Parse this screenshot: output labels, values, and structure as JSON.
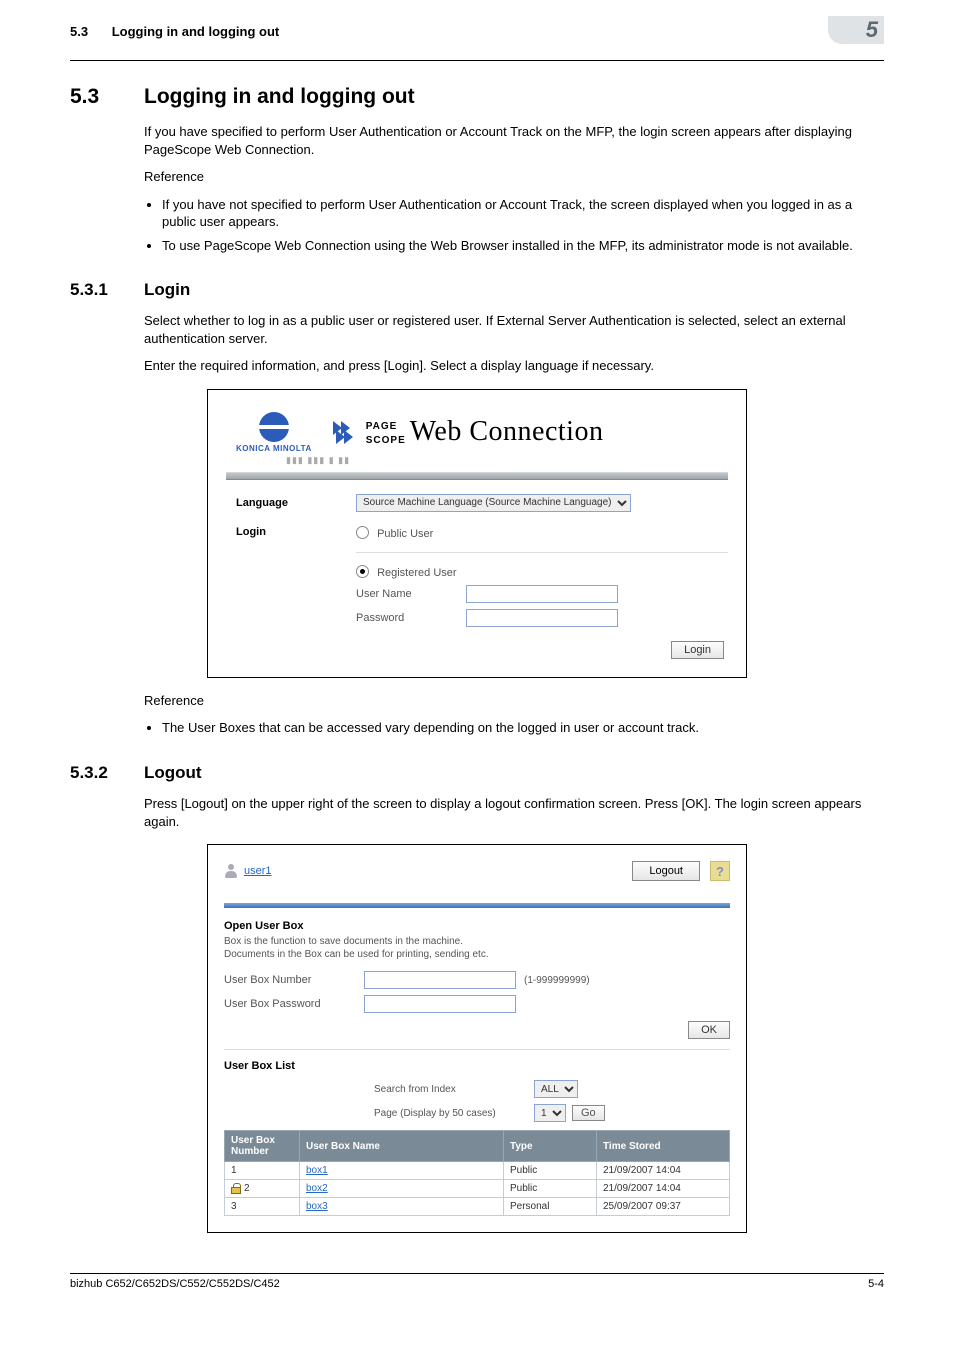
{
  "header": {
    "section_num": "5.3",
    "section_title": "Logging in and logging out",
    "chapter_num": "5"
  },
  "s53": {
    "num": "5.3",
    "title": "Logging in and logging out",
    "p1": "If you have specified to perform User Authentication or Account Track on the MFP, the login screen appears after displaying PageScope Web Connection.",
    "ref_label": "Reference",
    "b1": "If you have not specified to perform User Authentication or Account Track, the screen displayed when you logged in as a public user appears.",
    "b2": "To use PageScope Web Connection using the Web Browser installed in the MFP, its administrator mode is not available."
  },
  "s531": {
    "num": "5.3.1",
    "title": "Login",
    "p1": "Select whether to log in as a public user or registered user. If External Server Authentication is selected, select an external authentication server.",
    "p2": "Enter the required information, and press [Login]. Select a display language if necessary.",
    "ref_label": "Reference",
    "ref_b1": "The User Boxes that can be accessed vary depending on the logged in user or account track."
  },
  "ss1": {
    "konica": "KONICA MINOLTA",
    "page": "PAGE",
    "scope": "SCOPE",
    "web_connection": "Web Connection",
    "model_obscured": "▮▮▮ ▮▮▮ ▮ ▮▮",
    "language_label": "Language",
    "language_value": "Source Machine Language (Source Machine Language)",
    "login_label": "Login",
    "public_user": "Public User",
    "registered_user": "Registered User",
    "user_name": "User Name",
    "password": "Password",
    "login_btn": "Login"
  },
  "s532": {
    "num": "5.3.2",
    "title": "Logout",
    "p1": "Press [Logout] on the upper right of the screen to display a logout confirmation screen. Press [OK]. The login screen appears again."
  },
  "ss2": {
    "username": "user1",
    "logout_btn": "Logout",
    "help": "?",
    "open_box_title": "Open User Box",
    "open_box_desc1": "Box is the function to save documents in the machine.",
    "open_box_desc2": "Documents in the Box can be used for printing, sending etc.",
    "ub_number_label": "User Box Number",
    "ub_number_hint": "(1-999999999)",
    "ub_password_label": "User Box Password",
    "ok_btn": "OK",
    "ublist_title": "User Box List",
    "search_label": "Search from Index",
    "search_value": "ALL",
    "page_label": "Page (Display by 50 cases)",
    "page_value": "1",
    "go_btn": "Go",
    "th_num": "User Box Number",
    "th_name": "User Box Name",
    "th_type": "Type",
    "th_time": "Time Stored",
    "rows": [
      {
        "locked": false,
        "num": "1",
        "name": "box1",
        "type": "Public",
        "time": "21/09/2007 14:04"
      },
      {
        "locked": true,
        "num": "2",
        "name": "box2",
        "type": "Public",
        "time": "21/09/2007 14:04"
      },
      {
        "locked": false,
        "num": "3",
        "name": "box3",
        "type": "Personal",
        "time": "25/09/2007 09:37"
      }
    ]
  },
  "footer": {
    "left": "bizhub C652/C652DS/C552/C552DS/C452",
    "right": "5-4"
  }
}
